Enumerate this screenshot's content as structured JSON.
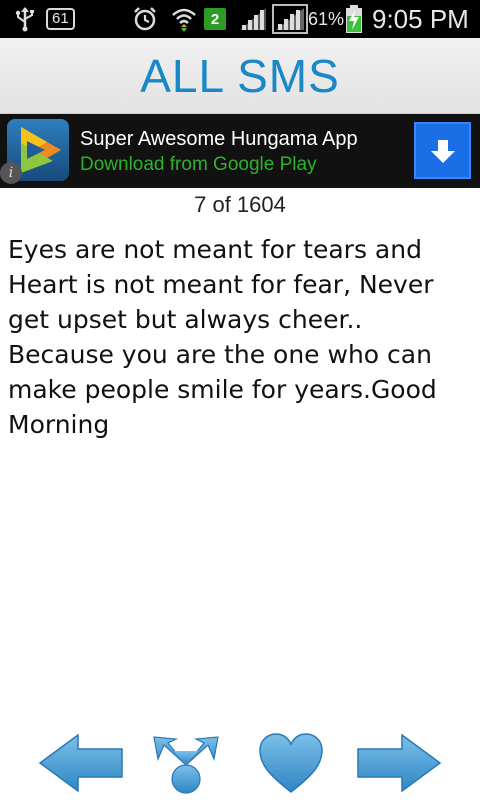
{
  "status_bar": {
    "notification_count": "61",
    "sim_indicator": "2",
    "battery_percent": "61%",
    "time": "9:05 PM",
    "icons": [
      "usb-icon",
      "notification-badge-icon",
      "alarm-icon",
      "wifi-icon",
      "sim-icon",
      "signal-icon",
      "battery-charging-icon"
    ]
  },
  "header": {
    "title": "ALL SMS"
  },
  "ad": {
    "title": "Super Awesome Hungama App",
    "subtitle": "Download from Google Play",
    "info_glyph": "i",
    "colors": {
      "background": "#111111",
      "subtitle": "#2db32a",
      "button": "#1a6ee6"
    }
  },
  "counter": {
    "text": "7 of 1604"
  },
  "message": {
    "text": "Eyes are not meant for tears and Heart is not meant for fear, Never get upset but always cheer.. Because you are the one who can make people smile for years.Good Morning"
  },
  "nav": {
    "icons": [
      "previous-arrow-icon",
      "share-icon",
      "favorite-heart-icon",
      "next-arrow-icon"
    ],
    "accent_color": "#4a9fd5"
  }
}
